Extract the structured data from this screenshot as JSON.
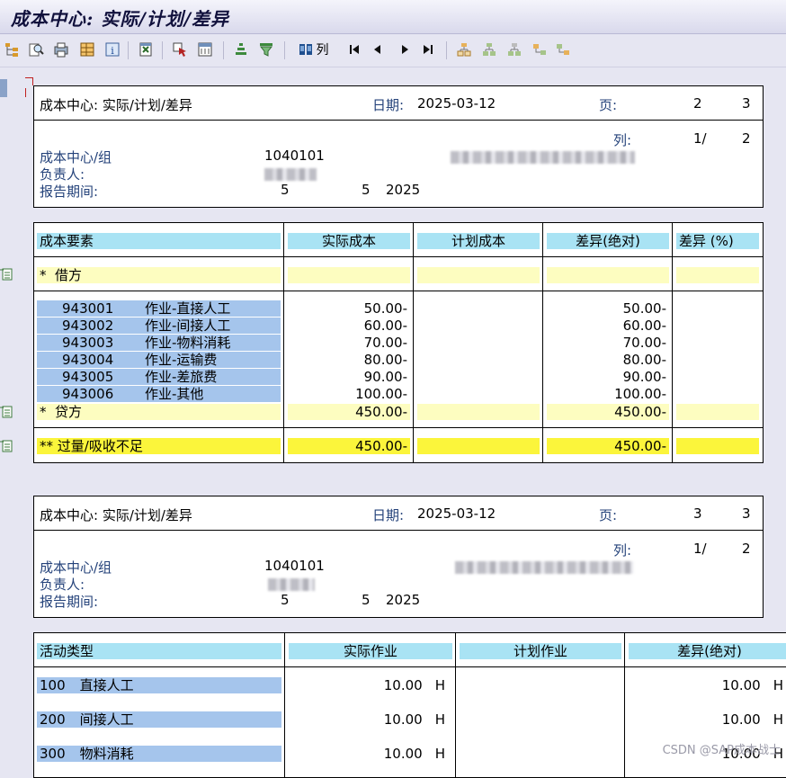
{
  "window": {
    "title": "成本中心: 实际/计划/差异"
  },
  "toolbar": {
    "col_label": "列"
  },
  "report1": {
    "title": "成本中心: 实际/计划/差异",
    "date_label": "日期:",
    "date": "2025-03-12",
    "page_label": "页:",
    "page_num": "2",
    "page_total": "3",
    "col_label": "列:",
    "col_num": "1/",
    "col_total": "2",
    "cc_label": "成本中心/组",
    "cc_value": "1040101",
    "owner_label": "负责人:",
    "period_label": "报告期间:",
    "period_from": "5",
    "period_to": "5",
    "period_year": "2025"
  },
  "table1": {
    "headers": [
      "成本要素",
      "实际成本",
      "计划成本",
      "差异(绝对)",
      "差异 (%)"
    ],
    "debit_label": "*  借方",
    "rows": [
      {
        "code": "943001",
        "name": "作业-直接人工",
        "actual": "50.00-",
        "variance": "50.00-"
      },
      {
        "code": "943002",
        "name": "作业-间接人工",
        "actual": "60.00-",
        "variance": "60.00-"
      },
      {
        "code": "943003",
        "name": "作业-物料消耗",
        "actual": "70.00-",
        "variance": "70.00-"
      },
      {
        "code": "943004",
        "name": "作业-运输费",
        "actual": "80.00-",
        "variance": "80.00-"
      },
      {
        "code": "943005",
        "name": "作业-差旅费",
        "actual": "90.00-",
        "variance": "90.00-"
      },
      {
        "code": "943006",
        "name": "作业-其他",
        "actual": "100.00-",
        "variance": "100.00-"
      }
    ],
    "credit_label": "*  贷方",
    "credit_actual": "450.00-",
    "credit_variance": "450.00-",
    "total_label": "** 过量/吸收不足",
    "total_actual": "450.00-",
    "total_variance": "450.00-"
  },
  "report2": {
    "title": "成本中心: 实际/计划/差异",
    "date_label": "日期:",
    "date": "2025-03-12",
    "page_label": "页:",
    "page_num": "3",
    "page_total": "3",
    "col_label": "列:",
    "col_num": "1/",
    "col_total": "2",
    "cc_label": "成本中心/组",
    "cc_value": "1040101",
    "owner_label": "负责人:",
    "period_label": "报告期间:",
    "period_from": "5",
    "period_to": "5",
    "period_year": "2025"
  },
  "table2": {
    "headers": [
      "活动类型",
      "实际作业",
      "计划作业",
      "差异(绝对)"
    ],
    "rows": [
      {
        "code": "100",
        "name": "直接人工",
        "actual": "10.00",
        "unit": "H",
        "variance": "10.00",
        "vunit": "H"
      },
      {
        "code": "200",
        "name": "间接人工",
        "actual": "10.00",
        "unit": "H",
        "variance": "10.00",
        "vunit": "H"
      },
      {
        "code": "300",
        "name": "物料消耗",
        "actual": "10.00",
        "unit": "H",
        "variance": "10.00",
        "vunit": "H"
      }
    ]
  },
  "watermark": "CSDN @SAP成本战士"
}
